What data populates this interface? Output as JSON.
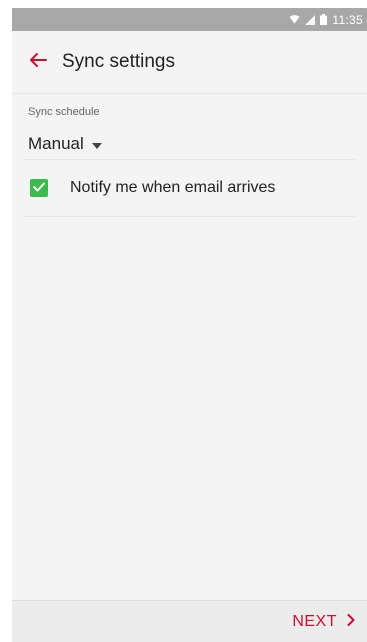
{
  "status_bar": {
    "time": "11:35"
  },
  "header": {
    "title": "Sync settings"
  },
  "sync_schedule": {
    "label": "Sync schedule",
    "selected": "Manual"
  },
  "notify": {
    "label": "Notify me when email arrives",
    "checked": true
  },
  "footer": {
    "next_label": "NEXT"
  },
  "colors": {
    "accent": "#c8102e",
    "checkbox": "#3dba4e",
    "status_bar": "#a8a8a8"
  },
  "icons": {
    "back": "arrow-left-icon",
    "dropdown": "caret-down-icon",
    "next": "chevron-right-icon"
  }
}
